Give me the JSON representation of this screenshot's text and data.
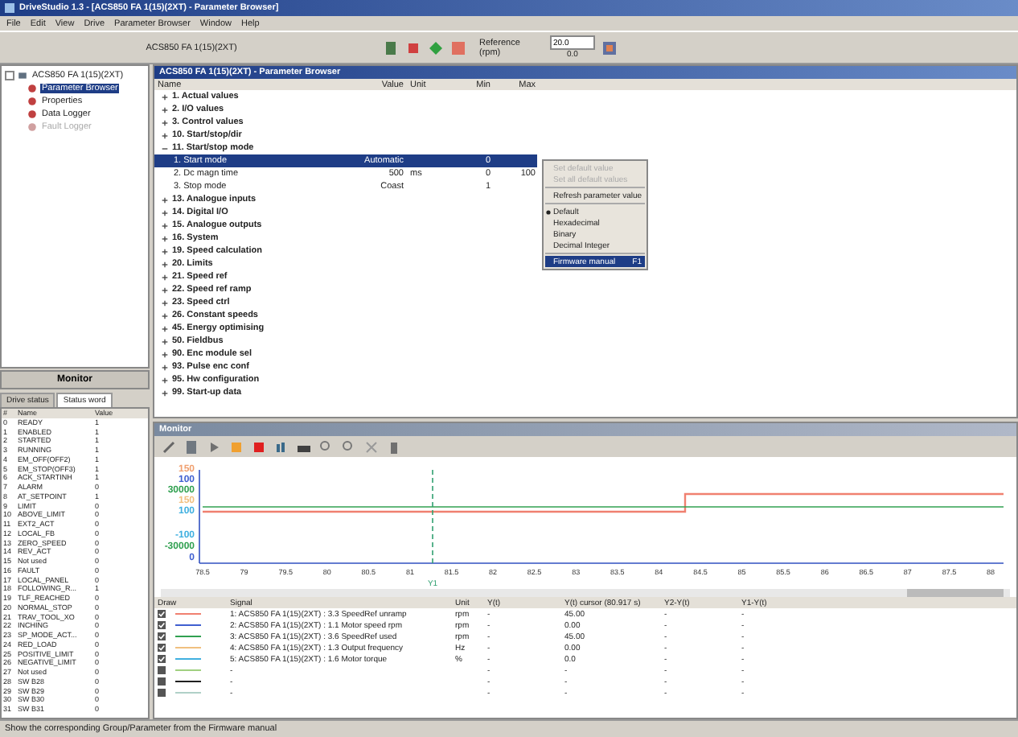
{
  "window": {
    "title": "DriveStudio 1.3 - [ACS850 FA 1(15)(2XT) - Parameter Browser]"
  },
  "menu": [
    "File",
    "Edit",
    "View",
    "Drive",
    "Parameter Browser",
    "Window",
    "Help"
  ],
  "toolbar": {
    "drive": "ACS850 FA 1(15)(2XT)",
    "reference_label": "Reference (rpm)",
    "reference_value": "20.0",
    "actual_value": "0.0"
  },
  "tree": {
    "root": "ACS850 FA 1(15)(2XT)",
    "items": [
      {
        "label": "Parameter Browser",
        "selected": true,
        "disabled": false
      },
      {
        "label": "Properties",
        "selected": false,
        "disabled": false
      },
      {
        "label": "Data Logger",
        "selected": false,
        "disabled": false
      },
      {
        "label": "Fault Logger",
        "selected": false,
        "disabled": true
      }
    ]
  },
  "monitor_button": "Monitor",
  "status_tabs": [
    {
      "label": "Drive status",
      "selected": false
    },
    {
      "label": "Status word",
      "selected": true
    }
  ],
  "status_table": {
    "columns": [
      "#",
      "Name",
      "Value"
    ],
    "rows": [
      [
        "0",
        "READY",
        "1"
      ],
      [
        "1",
        "ENABLED",
        "1"
      ],
      [
        "2",
        "STARTED",
        "1"
      ],
      [
        "3",
        "RUNNING",
        "1"
      ],
      [
        "4",
        "EM_OFF(OFF2)",
        "1"
      ],
      [
        "5",
        "EM_STOP(OFF3)",
        "1"
      ],
      [
        "6",
        "ACK_STARTINH",
        "1"
      ],
      [
        "7",
        "ALARM",
        "0"
      ],
      [
        "8",
        "AT_SETPOINT",
        "1"
      ],
      [
        "9",
        "LIMIT",
        "0"
      ],
      [
        "10",
        "ABOVE_LIMIT",
        "0"
      ],
      [
        "11",
        "EXT2_ACT",
        "0"
      ],
      [
        "12",
        "LOCAL_FB",
        "0"
      ],
      [
        "13",
        "ZERO_SPEED",
        "0"
      ],
      [
        "14",
        "REV_ACT",
        "0"
      ],
      [
        "15",
        "Not used",
        "0"
      ],
      [
        "16",
        "FAULT",
        "0"
      ],
      [
        "17",
        "LOCAL_PANEL",
        "0"
      ],
      [
        "18",
        "FOLLOWING_R...",
        "1"
      ],
      [
        "19",
        "TLF_REACHED",
        "0"
      ],
      [
        "20",
        "NORMAL_STOP",
        "0"
      ],
      [
        "21",
        "TRAV_TOOL_XO",
        "0"
      ],
      [
        "22",
        "INCHING",
        "0"
      ],
      [
        "23",
        "SP_MODE_ACT...",
        "0"
      ],
      [
        "24",
        "RED_LOAD",
        "0"
      ],
      [
        "25",
        "POSITIVE_LIMIT",
        "0"
      ],
      [
        "26",
        "NEGATIVE_LIMIT",
        "0"
      ],
      [
        "27",
        "Not used",
        "0"
      ],
      [
        "28",
        "SW B28",
        "0"
      ],
      [
        "29",
        "SW B29",
        "0"
      ],
      [
        "30",
        "SW B30",
        "0"
      ],
      [
        "31",
        "SW B31",
        "0"
      ]
    ]
  },
  "parameter_browser": {
    "title": "ACS850 FA 1(15)(2XT) - Parameter Browser",
    "columns": [
      "Name",
      "Value",
      "Unit",
      "Min",
      "Max"
    ],
    "groups": [
      {
        "name": "1. Actual values",
        "expanded": false
      },
      {
        "name": "2. I/O values",
        "expanded": false
      },
      {
        "name": "3. Control values",
        "expanded": false
      },
      {
        "name": "10. Start/stop/dir",
        "expanded": false
      },
      {
        "name": "11. Start/stop mode",
        "expanded": true,
        "children": [
          {
            "name": "1. Start mode",
            "value": "Automatic",
            "min": "0",
            "selected": true
          },
          {
            "name": "2. Dc magn time",
            "value": "500",
            "unit": "ms",
            "min": "0",
            "max": "100",
            "selected": false
          },
          {
            "name": "3. Stop mode",
            "value": "Coast",
            "min": "1",
            "selected": false
          }
        ]
      },
      {
        "name": "13. Analogue inputs",
        "expanded": false
      },
      {
        "name": "14. Digital I/O",
        "expanded": false
      },
      {
        "name": "15. Analogue outputs",
        "expanded": false
      },
      {
        "name": "16. System",
        "expanded": false
      },
      {
        "name": "19. Speed calculation",
        "expanded": false
      },
      {
        "name": "20. Limits",
        "expanded": false
      },
      {
        "name": "21. Speed ref",
        "expanded": false
      },
      {
        "name": "22. Speed ref ramp",
        "expanded": false
      },
      {
        "name": "23. Speed ctrl",
        "expanded": false
      },
      {
        "name": "26. Constant speeds",
        "expanded": false
      },
      {
        "name": "45. Energy optimising",
        "expanded": false
      },
      {
        "name": "50. Fieldbus",
        "expanded": false
      },
      {
        "name": "90. Enc module sel",
        "expanded": false
      },
      {
        "name": "93. Pulse enc conf",
        "expanded": false
      },
      {
        "name": "95. Hw configuration",
        "expanded": false
      },
      {
        "name": "99. Start-up data",
        "expanded": false
      }
    ]
  },
  "context_menu": {
    "groups": [
      [
        {
          "label": "Set default value",
          "disabled": true,
          "checked": false,
          "selected": false
        },
        {
          "label": "Set all default values",
          "disabled": true,
          "checked": false,
          "selected": false
        }
      ],
      [
        {
          "label": "Refresh parameter value",
          "disabled": false,
          "checked": false,
          "selected": false
        }
      ],
      [
        {
          "label": "Default",
          "disabled": false,
          "checked": true,
          "selected": false
        },
        {
          "label": "Hexadecimal",
          "disabled": false,
          "checked": false,
          "selected": false
        },
        {
          "label": "Binary",
          "disabled": false,
          "checked": false,
          "selected": false
        },
        {
          "label": "Decimal Integer",
          "disabled": false,
          "checked": false,
          "selected": false
        }
      ],
      [
        {
          "label": "Firmware manual",
          "shortcut": "F1",
          "disabled": false,
          "checked": false,
          "selected": true
        }
      ]
    ]
  },
  "monitor": {
    "title": "Monitor",
    "y_labels_top": [
      {
        "text": "150",
        "color": "#f0a070"
      },
      {
        "text": "100",
        "color": "#4060d0"
      },
      {
        "text": "30000",
        "color": "#30a050"
      },
      {
        "text": "150",
        "color": "#f0c080"
      },
      {
        "text": "100",
        "color": "#40b0e0"
      }
    ],
    "y_labels_bottom": [
      {
        "text": "-100",
        "color": "#40b0e0"
      },
      {
        "text": "-30000",
        "color": "#30a050"
      },
      {
        "text": "0",
        "color": "#4060d0"
      }
    ],
    "x_ticks": [
      "78.5",
      "79",
      "79.5",
      "80",
      "80.5",
      "81",
      "81.5",
      "82",
      "82.5",
      "83",
      "83.5",
      "84",
      "84.5",
      "85",
      "85.5",
      "86",
      "86.5",
      "87",
      "87.5",
      "88"
    ],
    "cursor_label": "Y1",
    "columns": [
      "Draw",
      "Signal",
      "Unit",
      "Y(t)",
      "Y(t) cursor (80.917 s)",
      "Y2-Y(t)",
      "Y1-Y(t)"
    ],
    "signals": [
      {
        "checked": true,
        "color": "#f08070",
        "signal": "1: ACS850 FA 1(15)(2XT) : 3.3 SpeedRef unramp",
        "unit": "rpm",
        "y": "-",
        "cursor": "45.00",
        "y2": "-",
        "y1": "-"
      },
      {
        "checked": true,
        "color": "#4060d0",
        "signal": "2: ACS850 FA 1(15)(2XT) : 1.1 Motor speed rpm",
        "unit": "rpm",
        "y": "-",
        "cursor": "0.00",
        "y2": "-",
        "y1": "-"
      },
      {
        "checked": true,
        "color": "#30a050",
        "signal": "3: ACS850 FA 1(15)(2XT) : 3.6 SpeedRef used",
        "unit": "rpm",
        "y": "-",
        "cursor": "45.00",
        "y2": "-",
        "y1": "-"
      },
      {
        "checked": true,
        "color": "#f0c080",
        "signal": "4: ACS850 FA 1(15)(2XT) : 1.3 Output frequency",
        "unit": "Hz",
        "y": "-",
        "cursor": "0.00",
        "y2": "-",
        "y1": "-"
      },
      {
        "checked": true,
        "color": "#40b0e0",
        "signal": "5: ACS850 FA 1(15)(2XT) : 1.6 Motor torque",
        "unit": "%",
        "y": "-",
        "cursor": "0.0",
        "y2": "-",
        "y1": "-"
      },
      {
        "checked": false,
        "color": "#a0d080",
        "signal": "-",
        "y": "-",
        "cursor": "-",
        "y2": "-",
        "y1": "-"
      },
      {
        "checked": false,
        "color": "#202020",
        "signal": "-",
        "y": "-",
        "cursor": "-",
        "y2": "-",
        "y1": "-"
      },
      {
        "checked": false,
        "color": "#b0d0c8",
        "signal": "-",
        "y": "-",
        "cursor": "-",
        "y2": "-",
        "y1": "-"
      }
    ]
  },
  "status_bar": "Show the corresponding Group/Parameter from the Firmware manual"
}
